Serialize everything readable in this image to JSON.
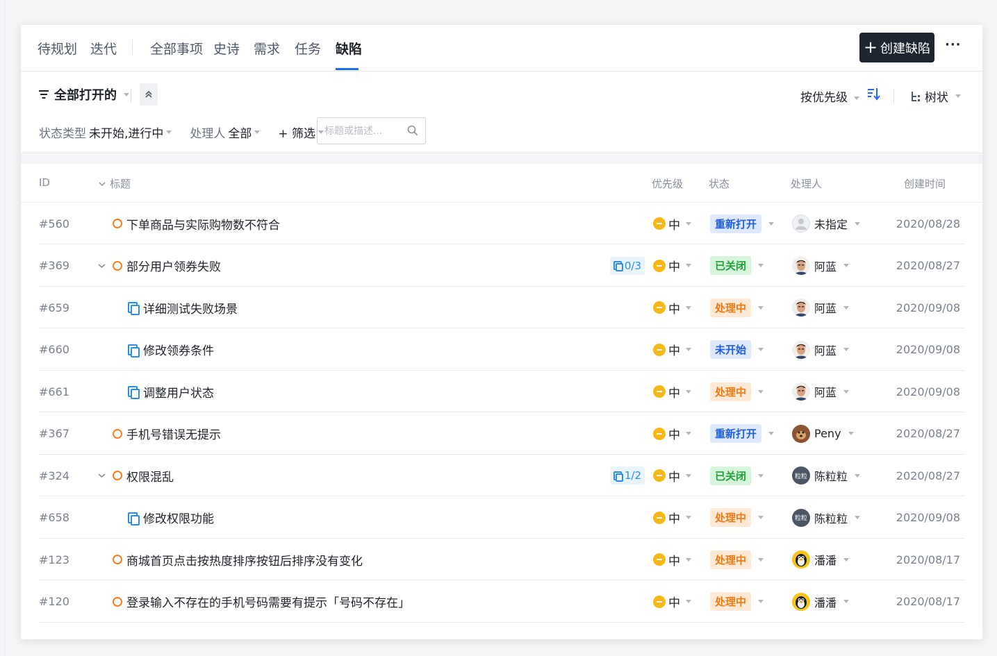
{
  "nav": {
    "tabs": [
      {
        "label": "待规划"
      },
      {
        "label": "迭代"
      },
      {
        "label": "全部事项"
      },
      {
        "label": "史诗"
      },
      {
        "label": "需求"
      },
      {
        "label": "任务"
      },
      {
        "label": "缺陷"
      }
    ],
    "active_tab": "缺陷",
    "create_label": "创建缺陷",
    "more_label": "···"
  },
  "toolbar": {
    "view_label": "全部打开的",
    "sort_label": "按优先级",
    "tree_label": "树状"
  },
  "filters": {
    "status_type_key": "状态类型",
    "status_type_value": "未开始,进行中",
    "owner_key": "处理人",
    "owner_value": "全部",
    "add_filter_label": "+ 筛选",
    "search_placeholder": "标题或描述..."
  },
  "table": {
    "headers": {
      "id": "ID",
      "title": "标题",
      "priority": "优先级",
      "status": "状态",
      "owner": "处理人",
      "created": "创建时间"
    },
    "rows": [
      {
        "id": "#560",
        "title": "下单商品与实际购物数不符合",
        "type": "bug",
        "level": 0,
        "expandable": false,
        "subcount": "",
        "priority": "中",
        "status": "重新打开",
        "status_kind": "reopen",
        "owner": "未指定",
        "avatar": "none",
        "date": "2020/08/28"
      },
      {
        "id": "#369",
        "title": "部分用户领券失败",
        "type": "bug",
        "level": 0,
        "expandable": true,
        "subcount": "0/3",
        "priority": "中",
        "status": "已关闭",
        "status_kind": "closed",
        "owner": "阿蓝",
        "avatar": "person",
        "date": "2020/08/27"
      },
      {
        "id": "#659",
        "title": "详细测试失败场景",
        "type": "task",
        "level": 1,
        "expandable": false,
        "subcount": "",
        "priority": "中",
        "status": "处理中",
        "status_kind": "doing",
        "owner": "阿蓝",
        "avatar": "person",
        "date": "2020/09/08"
      },
      {
        "id": "#660",
        "title": "修改领券条件",
        "type": "task",
        "level": 1,
        "expandable": false,
        "subcount": "",
        "priority": "中",
        "status": "未开始",
        "status_kind": "notstart",
        "owner": "阿蓝",
        "avatar": "person",
        "date": "2020/09/08"
      },
      {
        "id": "#661",
        "title": "调整用户状态",
        "type": "task",
        "level": 1,
        "expandable": false,
        "subcount": "",
        "priority": "中",
        "status": "处理中",
        "status_kind": "doing",
        "owner": "阿蓝",
        "avatar": "person",
        "date": "2020/09/08"
      },
      {
        "id": "#367",
        "title": "手机号错误无提示",
        "type": "bug",
        "level": 0,
        "expandable": false,
        "subcount": "",
        "priority": "中",
        "status": "重新打开",
        "status_kind": "reopen",
        "owner": "Peny",
        "avatar": "dog",
        "date": "2020/08/27"
      },
      {
        "id": "#324",
        "title": "权限混乱",
        "type": "bug",
        "level": 0,
        "expandable": true,
        "subcount": "1/2",
        "priority": "中",
        "status": "已关闭",
        "status_kind": "closed",
        "owner": "陈粒粒",
        "avatar": "text",
        "avatar_text": "粒粒",
        "date": "2020/08/27"
      },
      {
        "id": "#658",
        "title": "修改权限功能",
        "type": "task",
        "level": 1,
        "expandable": false,
        "subcount": "",
        "priority": "中",
        "status": "处理中",
        "status_kind": "doing",
        "owner": "陈粒粒",
        "avatar": "text",
        "avatar_text": "粒粒",
        "date": "2020/09/08"
      },
      {
        "id": "#123",
        "title": "商城首页点击按热度排序按钮后排序没有变化",
        "type": "bug",
        "level": 0,
        "expandable": false,
        "subcount": "",
        "priority": "中",
        "status": "处理中",
        "status_kind": "doing",
        "owner": "潘潘",
        "avatar": "penguin",
        "date": "2020/08/17"
      },
      {
        "id": "#120",
        "title": "登录输入不存在的手机号码需要有提示「号码不存在」",
        "type": "bug",
        "level": 0,
        "expandable": false,
        "subcount": "",
        "priority": "中",
        "status": "处理中",
        "status_kind": "doing",
        "owner": "潘潘",
        "avatar": "penguin",
        "date": "2020/08/17"
      }
    ]
  },
  "colors": {
    "accent": "#1a6cf0",
    "create_button_bg": "#1d2530",
    "priority_medium": "#f7b715",
    "bug_icon": "#f0801f",
    "task_icon": "#2b8de9"
  }
}
